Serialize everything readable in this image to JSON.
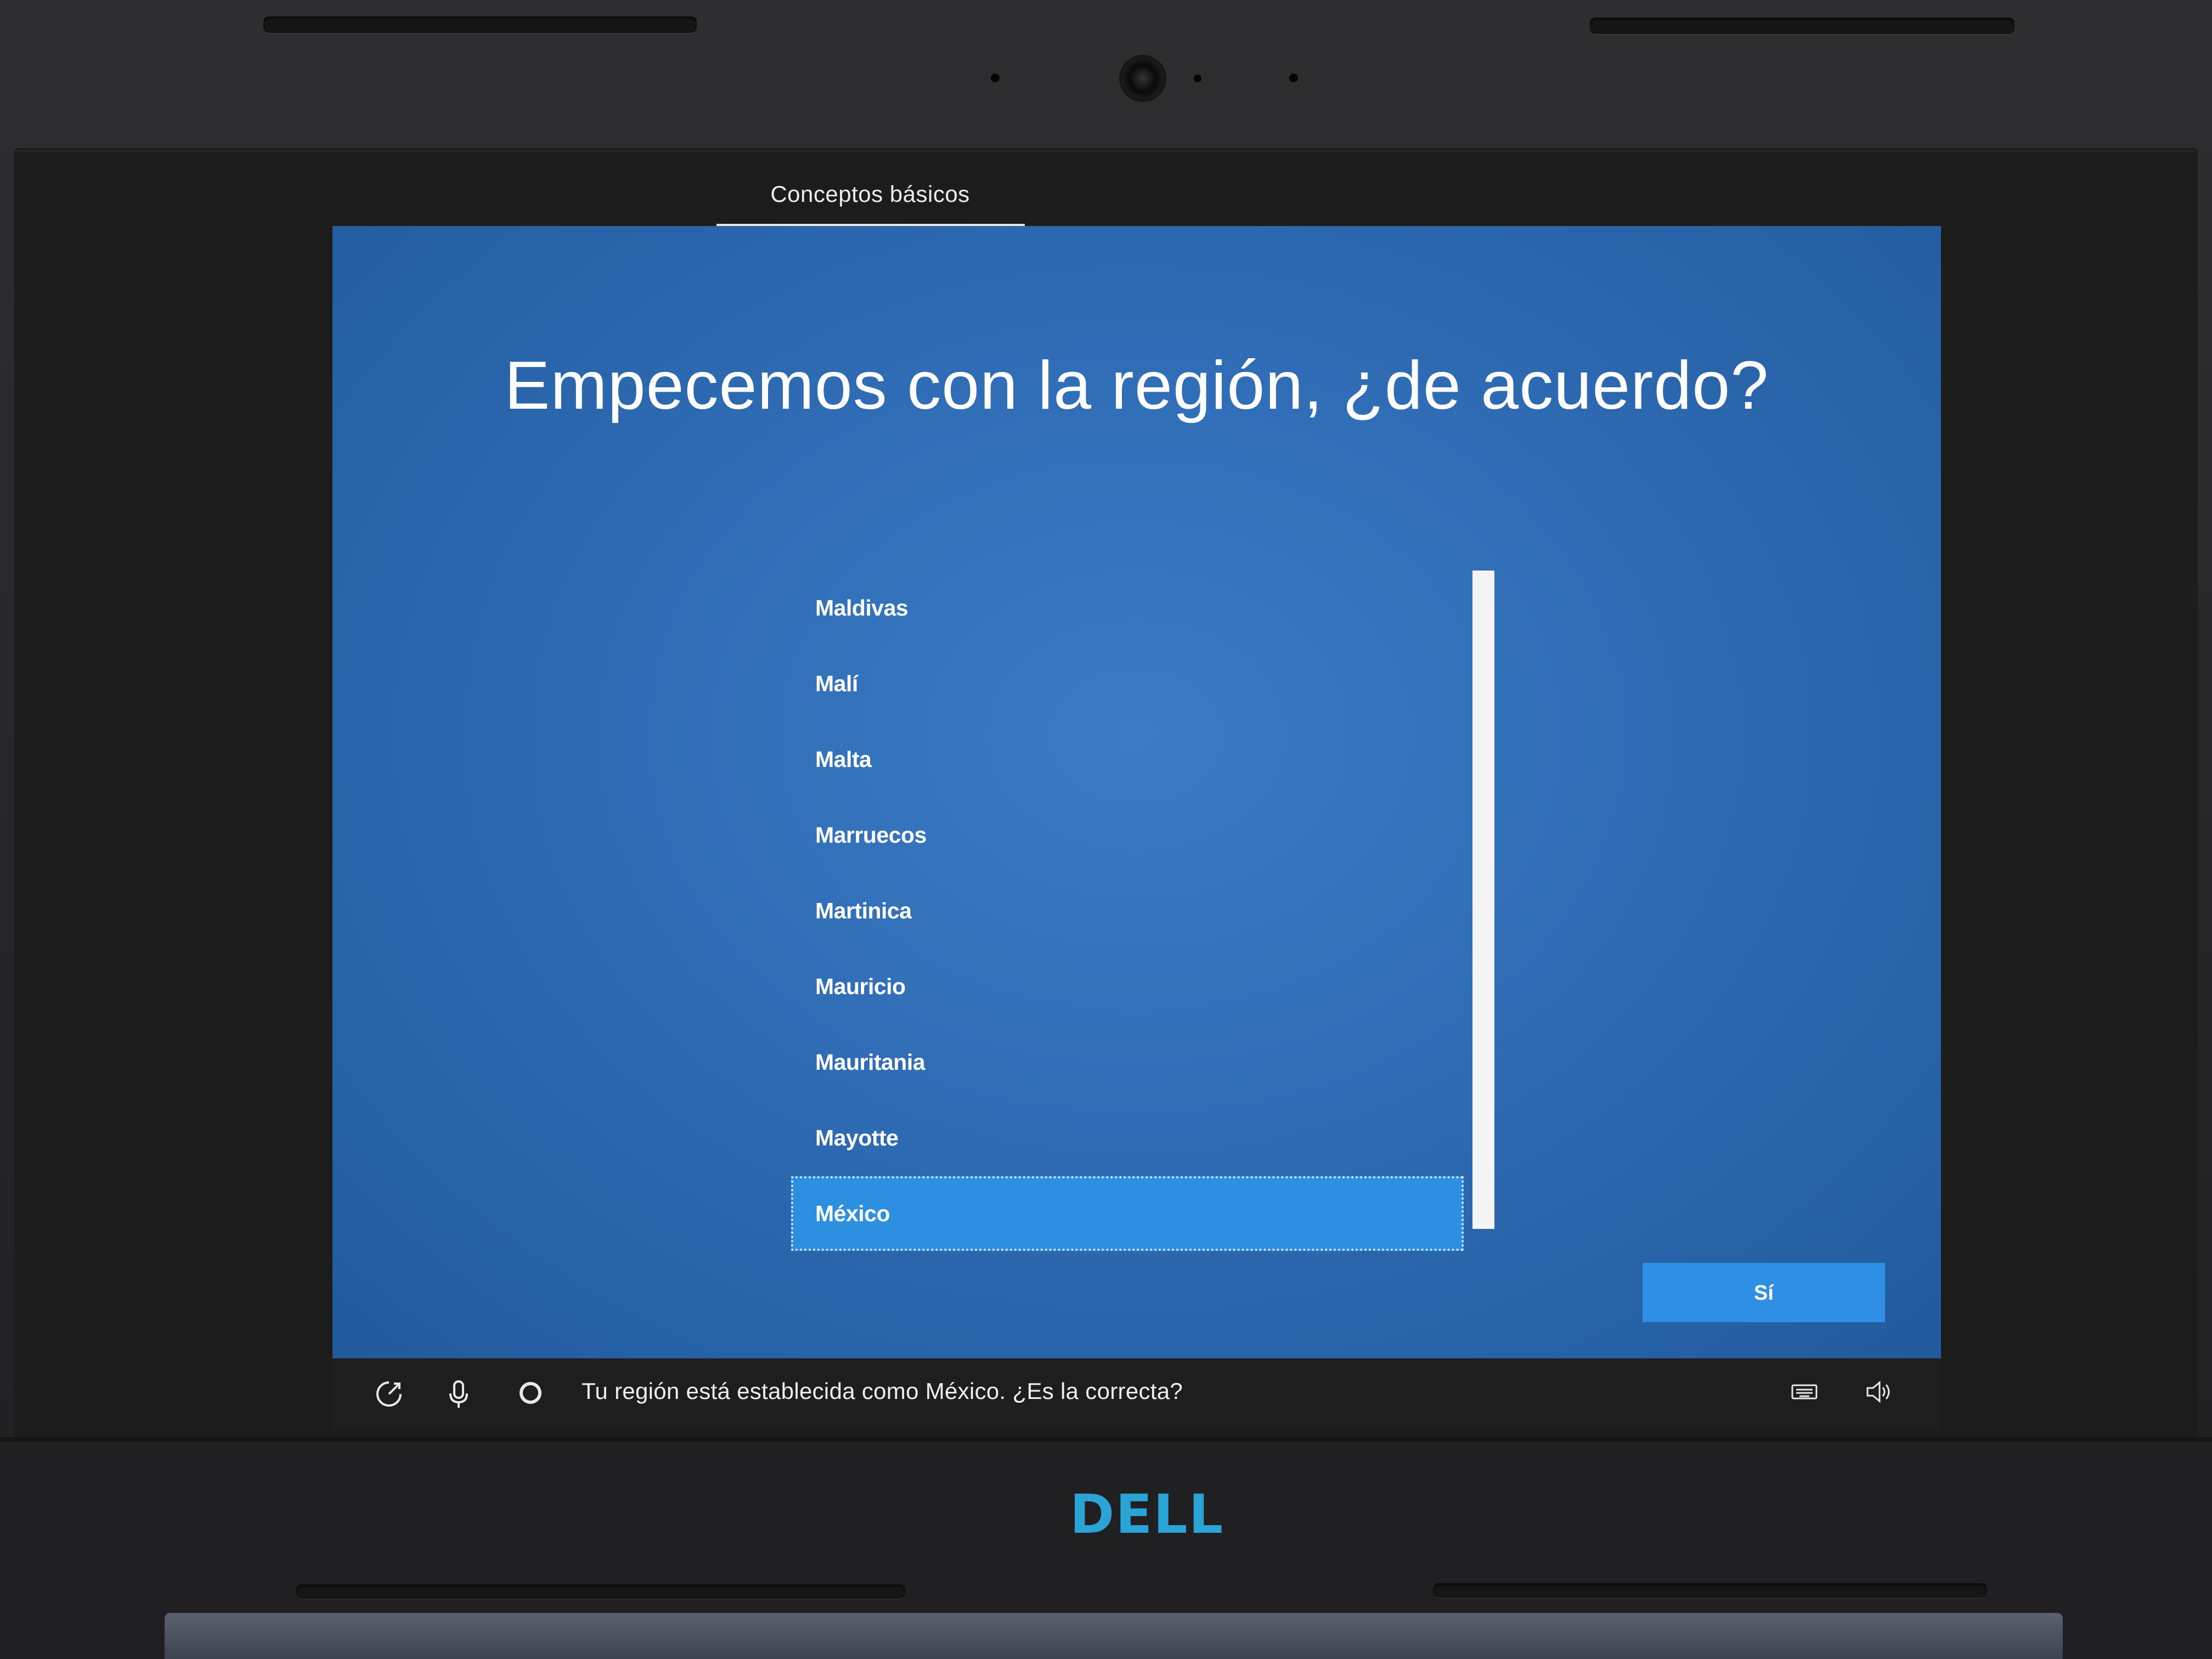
{
  "setup": {
    "section_tab": "Conceptos básicos",
    "title": "Empecemos con la región, ¿de acuerdo?",
    "regions": [
      {
        "label": "Maldivas",
        "selected": false
      },
      {
        "label": "Malí",
        "selected": false
      },
      {
        "label": "Malta",
        "selected": false
      },
      {
        "label": "Marruecos",
        "selected": false
      },
      {
        "label": "Martinica",
        "selected": false
      },
      {
        "label": "Mauricio",
        "selected": false
      },
      {
        "label": "Mauritania",
        "selected": false
      },
      {
        "label": "Mayotte",
        "selected": false
      },
      {
        "label": "México",
        "selected": true
      }
    ],
    "confirm_label": "Sí"
  },
  "bottom_bar": {
    "narration": "Tu región está establecida como México. ¿Es la correcta?",
    "icons": [
      "ease-of-access-icon",
      "microphone-icon",
      "cortana-icon",
      "keyboard-icon",
      "volume-icon"
    ]
  },
  "device": {
    "brand": "DELL"
  },
  "colors": {
    "background_blue": "#2f6cb5",
    "selection_blue": "#2d8fe0",
    "button_blue": "#2f8fe4",
    "brand_blue": "#2aa3d6"
  }
}
